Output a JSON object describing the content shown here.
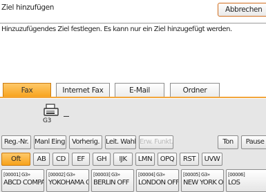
{
  "header": {
    "title": "Ziel hinzufügen",
    "cancel_label": "Abbrechen",
    "hint": "Hinzuzufügendes Ziel festlegen. Es kann nur ein Ziel hinzugefügt werden."
  },
  "tabs": [
    {
      "label": "Fax",
      "active": true
    },
    {
      "label": "Internet Fax",
      "active": false
    },
    {
      "label": "E-Mail",
      "active": false
    },
    {
      "label": "Ordner",
      "active": false
    }
  ],
  "line": {
    "label": "G3",
    "icon": "fax-machine-icon"
  },
  "function_buttons": [
    {
      "label": "Reg.-Nr.",
      "disabled": false
    },
    {
      "label": "Manl Eing.",
      "disabled": false
    },
    {
      "label": "Vorherig.",
      "disabled": false
    },
    {
      "label": "Leit. Wahl",
      "disabled": false
    },
    {
      "label": "Erw. Funkt.",
      "disabled": true
    },
    {
      "label": "Ton",
      "disabled": false
    },
    {
      "label": "Pause",
      "disabled": false
    }
  ],
  "index_tabs": [
    {
      "label": "Oft",
      "active": true
    },
    {
      "label": "AB",
      "active": false
    },
    {
      "label": "CD",
      "active": false
    },
    {
      "label": "EF",
      "active": false
    },
    {
      "label": "GH",
      "active": false
    },
    {
      "label": "IJK",
      "active": false
    },
    {
      "label": "LMN",
      "active": false
    },
    {
      "label": "OPQ",
      "active": false
    },
    {
      "label": "RST",
      "active": false
    },
    {
      "label": "UVW",
      "active": false
    }
  ],
  "destinations": [
    {
      "code": "[00001] G3»",
      "name": "ABCD COMPA"
    },
    {
      "code": "[00002] G3»",
      "name": "YOKOHAMA O"
    },
    {
      "code": "[00003] G3»",
      "name": "BERLIN OFF"
    },
    {
      "code": "[00004] G3»",
      "name": "LONDON OFF"
    },
    {
      "code": "[00005] G3»",
      "name": "NEW YORK O"
    },
    {
      "code": "[00006]",
      "name": "LOS"
    }
  ],
  "colors": {
    "accent": "#f7a21b",
    "cancel_border": "#d06c1c",
    "panel": "#e6e6e6"
  }
}
